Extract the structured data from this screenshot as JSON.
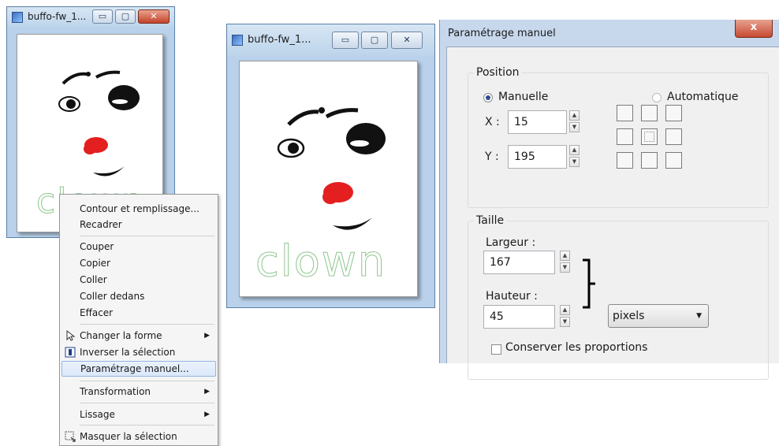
{
  "window_small": {
    "title": "buffo-fw_1...",
    "minimize_label": "▭",
    "maximize_label": "▢",
    "close_label": "✕"
  },
  "window_large": {
    "title": "buffo-fw_1...",
    "minimize_label": "▭",
    "maximize_label": "▢",
    "close_label": "✕"
  },
  "canvas_text": "clown",
  "context_menu": {
    "items": [
      {
        "label": "Contour et remplissage..."
      },
      {
        "label": "Recadrer"
      },
      {
        "label": "Couper"
      },
      {
        "label": "Copier"
      },
      {
        "label": "Coller"
      },
      {
        "label": "Coller dedans"
      },
      {
        "label": "Effacer"
      },
      {
        "label": "Changer la forme",
        "icon": "cursor-arrow-icon",
        "submenu": true
      },
      {
        "label": "Inverser la sélection",
        "icon": "invert-selection-icon"
      },
      {
        "label": "Paramétrage manuel...",
        "highlighted": true
      },
      {
        "label": "Transformation",
        "submenu": true
      },
      {
        "label": "Lissage",
        "submenu": true
      },
      {
        "label": "Masquer la sélection",
        "icon": "hide-selection-icon"
      }
    ]
  },
  "dialog": {
    "title": "Paramétrage manuel",
    "close_label": "x",
    "position": {
      "group_label": "Position",
      "manual_label": "Manuelle",
      "auto_label": "Automatique",
      "x_label": "X :",
      "x_value": "15",
      "y_label": "Y :",
      "y_value": "195"
    },
    "size": {
      "group_label": "Taille",
      "width_label": "Largeur :",
      "width_value": "167",
      "height_label": "Hauteur :",
      "height_value": "45",
      "unit_selected": "pixels",
      "keep_ratio_label": "Conserver les proportions"
    }
  },
  "colors": {
    "title_bar": "#bcd4ea",
    "menu_highlight": "#dbe8fa",
    "clown_nose": "#e41f1f",
    "clown_outline_text": "#8fc68f"
  }
}
